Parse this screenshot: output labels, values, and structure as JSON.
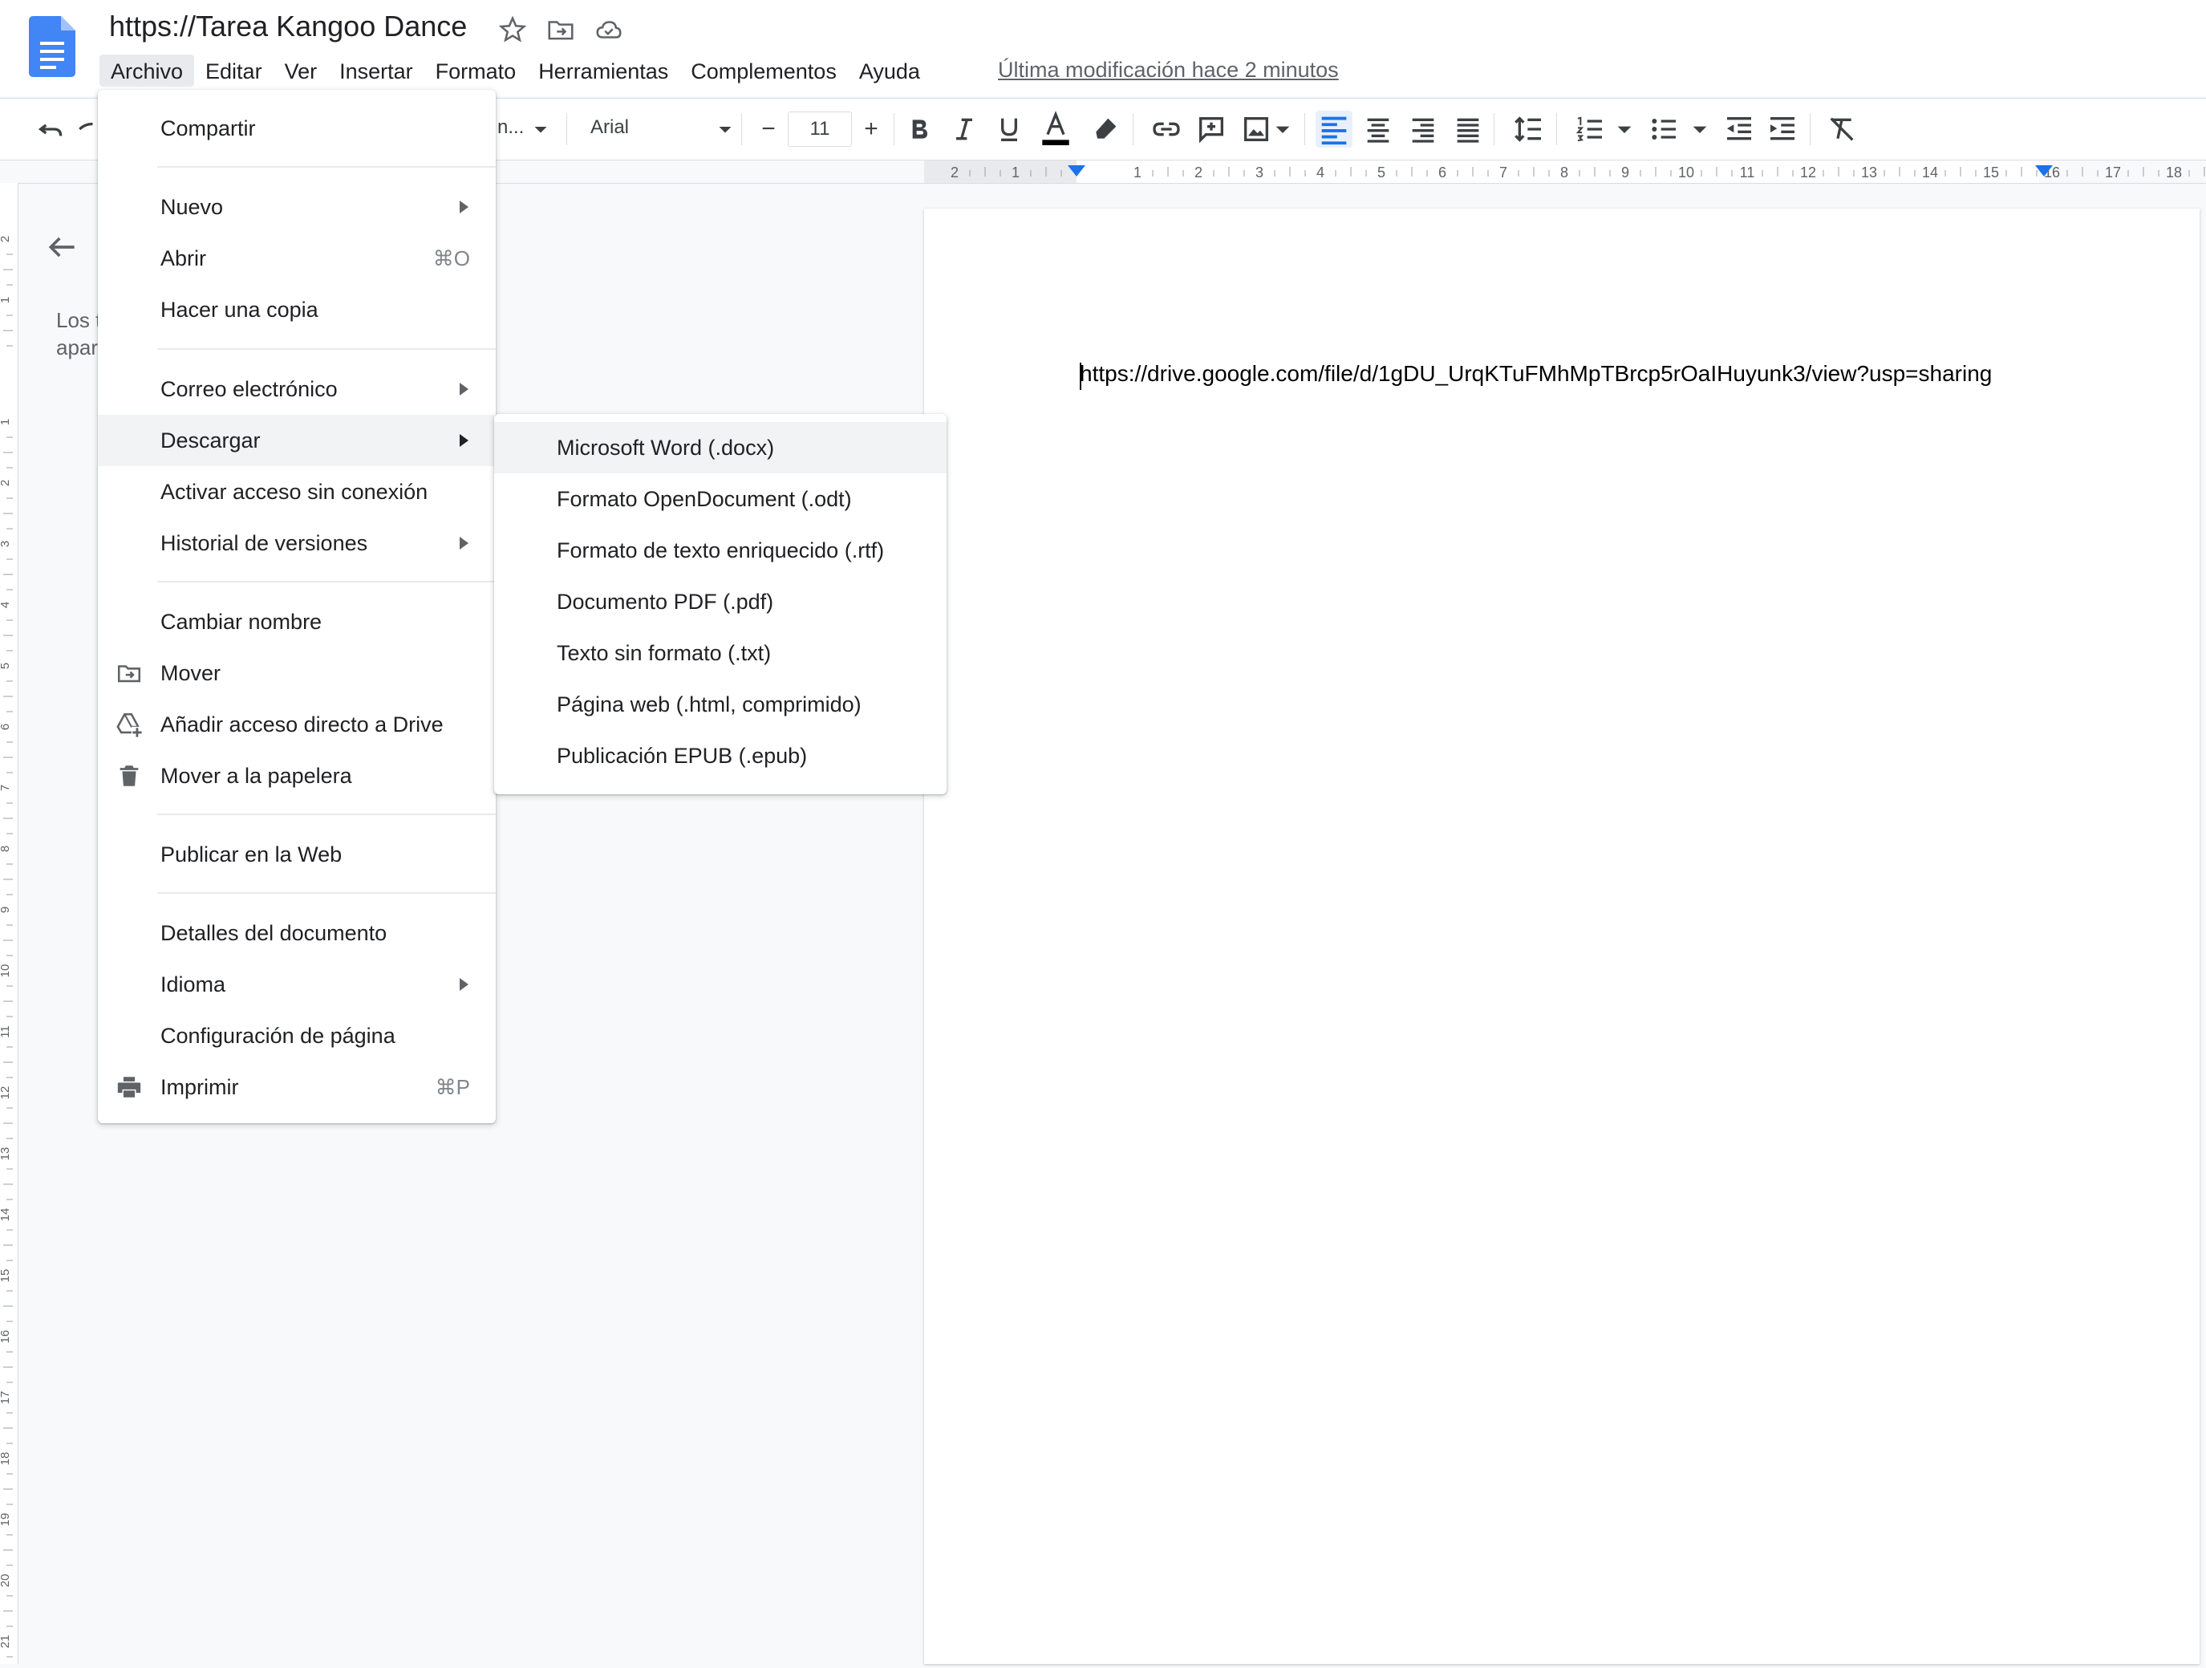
{
  "document": {
    "title": "https://Tarea Kangoo Dance",
    "last_modified": "Última modificación hace 2 minutos",
    "body_text": "https://drive.google.com/file/d/1gDU_UrqKTuFMhMpTBrcp5rOaIHuyunk3/view?usp=sharing"
  },
  "menubar": [
    {
      "label": "Archivo"
    },
    {
      "label": "Editar"
    },
    {
      "label": "Ver"
    },
    {
      "label": "Insertar"
    },
    {
      "label": "Formato"
    },
    {
      "label": "Herramientas"
    },
    {
      "label": "Complementos"
    },
    {
      "label": "Ayuda"
    }
  ],
  "toolbar": {
    "style_label": "n...",
    "font_label": "Arial",
    "font_size": "11",
    "minus": "−",
    "plus": "+"
  },
  "ruler": {
    "top_ticks": [
      "2",
      "1",
      "1",
      "2",
      "3",
      "4",
      "5",
      "6",
      "7",
      "8",
      "9",
      "10",
      "11",
      "12",
      "13",
      "14",
      "15",
      "16",
      "17",
      "18"
    ],
    "left_ticks": [
      "2",
      "1",
      "1",
      "2",
      "3",
      "4",
      "5",
      "6",
      "7",
      "8",
      "9",
      "10",
      "11",
      "12",
      "13",
      "14",
      "15",
      "16",
      "17",
      "18",
      "19",
      "20",
      "21"
    ]
  },
  "outline": {
    "line1": "Los t",
    "line2": "apar"
  },
  "file_menu": {
    "items": {
      "compartir": "Compartir",
      "nuevo": "Nuevo",
      "abrir": "Abrir",
      "abrir_shortcut": "⌘O",
      "copia": "Hacer una copia",
      "correo": "Correo electrónico",
      "descargar": "Descargar",
      "sin_conexion": "Activar acceso sin conexión",
      "historial": "Historial de versiones",
      "cambiar_nombre": "Cambiar nombre",
      "mover": "Mover",
      "acceso_directo": "Añadir acceso directo a Drive",
      "papelera": "Mover a la papelera",
      "publicar": "Publicar en la Web",
      "detalles": "Detalles del documento",
      "idioma": "Idioma",
      "config_pagina": "Configuración de página",
      "imprimir": "Imprimir",
      "imprimir_shortcut": "⌘P"
    }
  },
  "download_menu": {
    "items": [
      "Microsoft Word (.docx)",
      "Formato OpenDocument (.odt)",
      "Formato de texto enriquecido (.rtf)",
      "Documento PDF (.pdf)",
      "Texto sin formato (.txt)",
      "Página web (.html, comprimido)",
      "Publicación EPUB (.epub)"
    ]
  },
  "colors": {
    "docs_blue": "#4285f4",
    "text_color_bar": "#000000",
    "active_align": "#1a73e8"
  }
}
